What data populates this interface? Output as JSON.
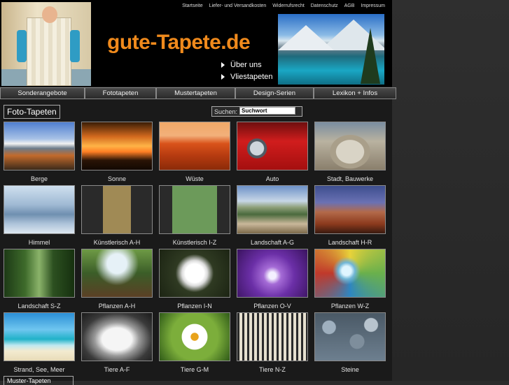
{
  "header": {
    "top_links": [
      "Startseite",
      "Liefer- und Versandkosten",
      "Widerrufsrecht",
      "Datenschutz",
      "AGB",
      "Impressum"
    ],
    "logo": "gute-Tapete.de",
    "nav": [
      "Über uns",
      "Vliestapeten"
    ]
  },
  "navbar": [
    "Sonderangebote",
    "Fototapeten",
    "Mustertapeten",
    "Design-Serien",
    "Lexikon + Infos"
  ],
  "section_title": "Foto-Tapeten",
  "search": {
    "label": "Suchen:",
    "value": "Suchwort"
  },
  "tiles": [
    {
      "label": "Berge",
      "theme": "mountains"
    },
    {
      "label": "Sonne",
      "theme": "sunset"
    },
    {
      "label": "Wüste",
      "theme": "desert"
    },
    {
      "label": "Auto",
      "theme": "car"
    },
    {
      "label": "Stadt, Bauwerke",
      "theme": "city"
    },
    {
      "label": "Himmel",
      "theme": "sky"
    },
    {
      "label": "Künstlerisch A-H",
      "theme": "art1"
    },
    {
      "label": "Künstlerisch I-Z",
      "theme": "art2"
    },
    {
      "label": "Landschaft A-G",
      "theme": "land1"
    },
    {
      "label": "Landschaft H-R",
      "theme": "land2"
    },
    {
      "label": "Landschaft S-Z",
      "theme": "forest"
    },
    {
      "label": "Pflanzen A-H",
      "theme": "trees"
    },
    {
      "label": "Pflanzen I-N",
      "theme": "dandelion"
    },
    {
      "label": "Pflanzen O-V",
      "theme": "violet"
    },
    {
      "label": "Pflanzen W-Z",
      "theme": "drop"
    },
    {
      "label": "Strand, See, Meer",
      "theme": "beach"
    },
    {
      "label": "Tiere A-F",
      "theme": "cat"
    },
    {
      "label": "Tiere G-M",
      "theme": "daisy"
    },
    {
      "label": "Tiere N-Z",
      "theme": "zebra"
    },
    {
      "label": "Steine",
      "theme": "stones"
    }
  ],
  "bottom_box": "Muster-Tapeten"
}
